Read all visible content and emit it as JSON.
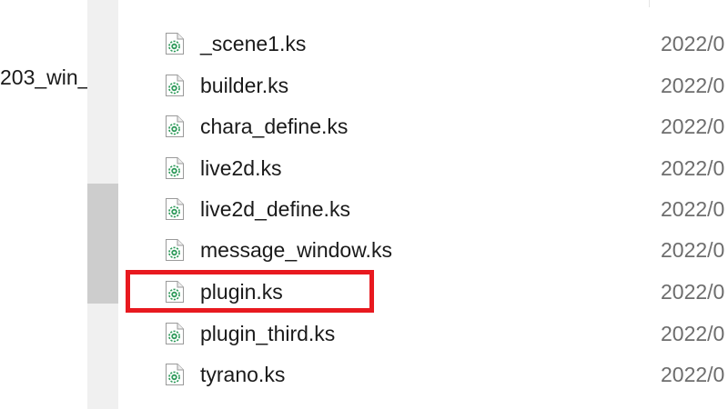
{
  "navigation": {
    "folder_label": "203_win_"
  },
  "files": [
    {
      "name": "_scene1.ks",
      "date": "2022/0",
      "icon": "ks-script-file-icon"
    },
    {
      "name": "builder.ks",
      "date": "2022/0",
      "icon": "ks-script-file-icon"
    },
    {
      "name": "chara_define.ks",
      "date": "2022/0",
      "icon": "ks-script-file-icon"
    },
    {
      "name": "live2d.ks",
      "date": "2022/0",
      "icon": "ks-script-file-icon"
    },
    {
      "name": "live2d_define.ks",
      "date": "2022/0",
      "icon": "ks-script-file-icon"
    },
    {
      "name": "message_window.ks",
      "date": "2022/0",
      "icon": "ks-script-file-icon"
    },
    {
      "name": "plugin.ks",
      "date": "2022/0",
      "icon": "ks-script-file-icon"
    },
    {
      "name": "plugin_third.ks",
      "date": "2022/0",
      "icon": "ks-script-file-icon"
    },
    {
      "name": "tyrano.ks",
      "date": "2022/0",
      "icon": "ks-script-file-icon"
    }
  ],
  "highlight": {
    "target_file": "plugin.ks",
    "color": "#e8191f"
  },
  "colors": {
    "icon_green": "#2e9a5a",
    "scroll_track": "#f0f0f0",
    "scroll_thumb": "#cdcdcd"
  }
}
